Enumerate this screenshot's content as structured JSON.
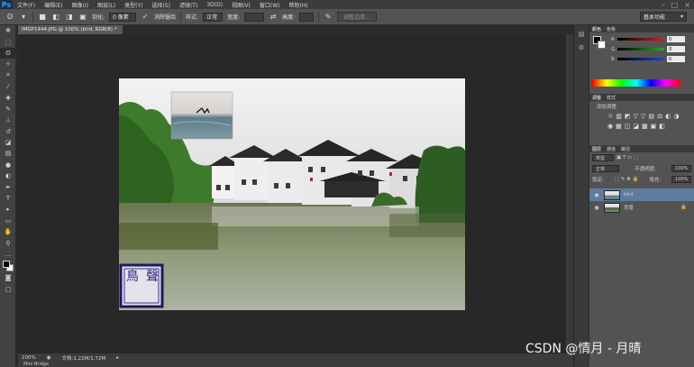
{
  "app": {
    "logo": "Ps"
  },
  "menu": [
    "文件(F)",
    "编辑(E)",
    "图像(I)",
    "图层(L)",
    "类型(Y)",
    "选择(S)",
    "滤镜(T)",
    "3D(D)",
    "视图(V)",
    "窗口(W)",
    "帮助(H)"
  ],
  "window_controls": [
    "–",
    "□",
    "×"
  ],
  "options": {
    "feather_label": "羽化:",
    "feather_value": "0 像素",
    "antialias_label": "消除锯齿",
    "style_label": "样式:",
    "style_value": "正常",
    "width_label": "宽度:",
    "width_value": "",
    "height_label": "高度:",
    "height_value": "",
    "refine_edge": "调整边缘...",
    "workspace": "基本功能"
  },
  "document": {
    "tab_title": "IMGP1444.JPG @ 100% (bird, RGB/8) *",
    "zoom": "100%",
    "doc_size": "文档:1.22M/1.72M"
  },
  "bottom_tabs": "Mini Bridge",
  "panels": {
    "color_tabs": [
      "颜色",
      "色板"
    ],
    "channels": [
      {
        "label": "R",
        "value": "0",
        "color": "#d42020"
      },
      {
        "label": "G",
        "value": "0",
        "color": "#20b020"
      },
      {
        "label": "B",
        "value": "0",
        "color": "#2040d8"
      }
    ],
    "adjustments_tabs": [
      "调整",
      "样式"
    ],
    "adjustments_title": "添加调整",
    "adjust_icons": [
      "☼",
      "▥",
      "◩",
      "▽",
      "▽",
      "▤",
      "⚖",
      "◐",
      "◑",
      "◉",
      "▦",
      "◫",
      "◪",
      "▩",
      "▣",
      "◧"
    ],
    "layers_tabs": [
      "图层",
      "通道",
      "路径"
    ],
    "layer_kind": "类型",
    "blend_mode": "正常",
    "opacity_label": "不透明度:",
    "opacity_value": "100%",
    "lock_label": "锁定:",
    "fill_label": "填充:",
    "fill_value": "100%",
    "layers": [
      {
        "name": "bird",
        "selected": true
      },
      {
        "name": "背景",
        "selected": false
      }
    ]
  },
  "canvas_stamp": [
    "鳥",
    "聲"
  ],
  "watermark": "CSDN @情月 - 月晴"
}
